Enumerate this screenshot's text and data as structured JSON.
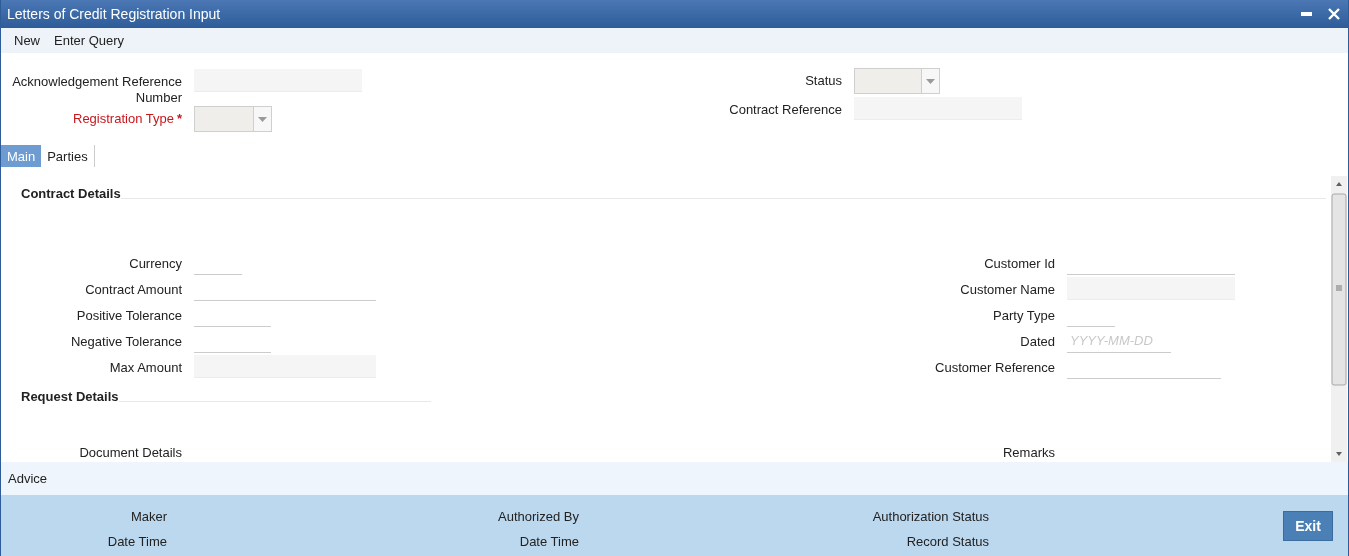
{
  "window": {
    "title": "Letters of Credit Registration Input"
  },
  "toolbar": [
    "New",
    "Enter Query"
  ],
  "header": {
    "left": [
      {
        "label": "Acknowledgement Reference Number",
        "kind": "readonly",
        "required": false
      },
      {
        "label": "Registration Type",
        "kind": "select",
        "required": true,
        "mark": "*"
      }
    ],
    "right": [
      {
        "label": "Status",
        "kind": "select",
        "required": false
      },
      {
        "label": "Contract Reference",
        "kind": "readonly",
        "required": false
      }
    ]
  },
  "tabs": [
    {
      "label": "Main",
      "selected": true
    },
    {
      "label": "Parties",
      "selected": false
    }
  ],
  "sections": [
    {
      "title": "Contract Details",
      "left": [
        {
          "label": "Currency",
          "kind": "text"
        },
        {
          "label": "Contract Amount",
          "kind": "text"
        },
        {
          "label": "Positive Tolerance",
          "kind": "text"
        },
        {
          "label": "Negative Tolerance",
          "kind": "text"
        },
        {
          "label": "Max Amount",
          "kind": "readonly"
        }
      ],
      "right": [
        {
          "label": "Customer Id",
          "kind": "text"
        },
        {
          "label": "Customer Name",
          "kind": "readonly"
        },
        {
          "label": "Party Type",
          "kind": "text"
        },
        {
          "label": "Dated",
          "kind": "date",
          "placeholder": "YYYY-MM-DD"
        },
        {
          "label": "Customer Reference",
          "kind": "text"
        }
      ]
    },
    {
      "title": "Request Details",
      "left": [
        {
          "label": "Document Details",
          "kind": "label"
        }
      ],
      "right": [
        {
          "label": "Remarks",
          "kind": "label"
        }
      ]
    }
  ],
  "advice": "Advice",
  "footer": {
    "columns": [
      [
        "Maker",
        "Date Time"
      ],
      [
        "Authorized By",
        "Date Time"
      ],
      [
        "Authorization Status",
        "Record Status"
      ]
    ],
    "button": "Exit"
  }
}
